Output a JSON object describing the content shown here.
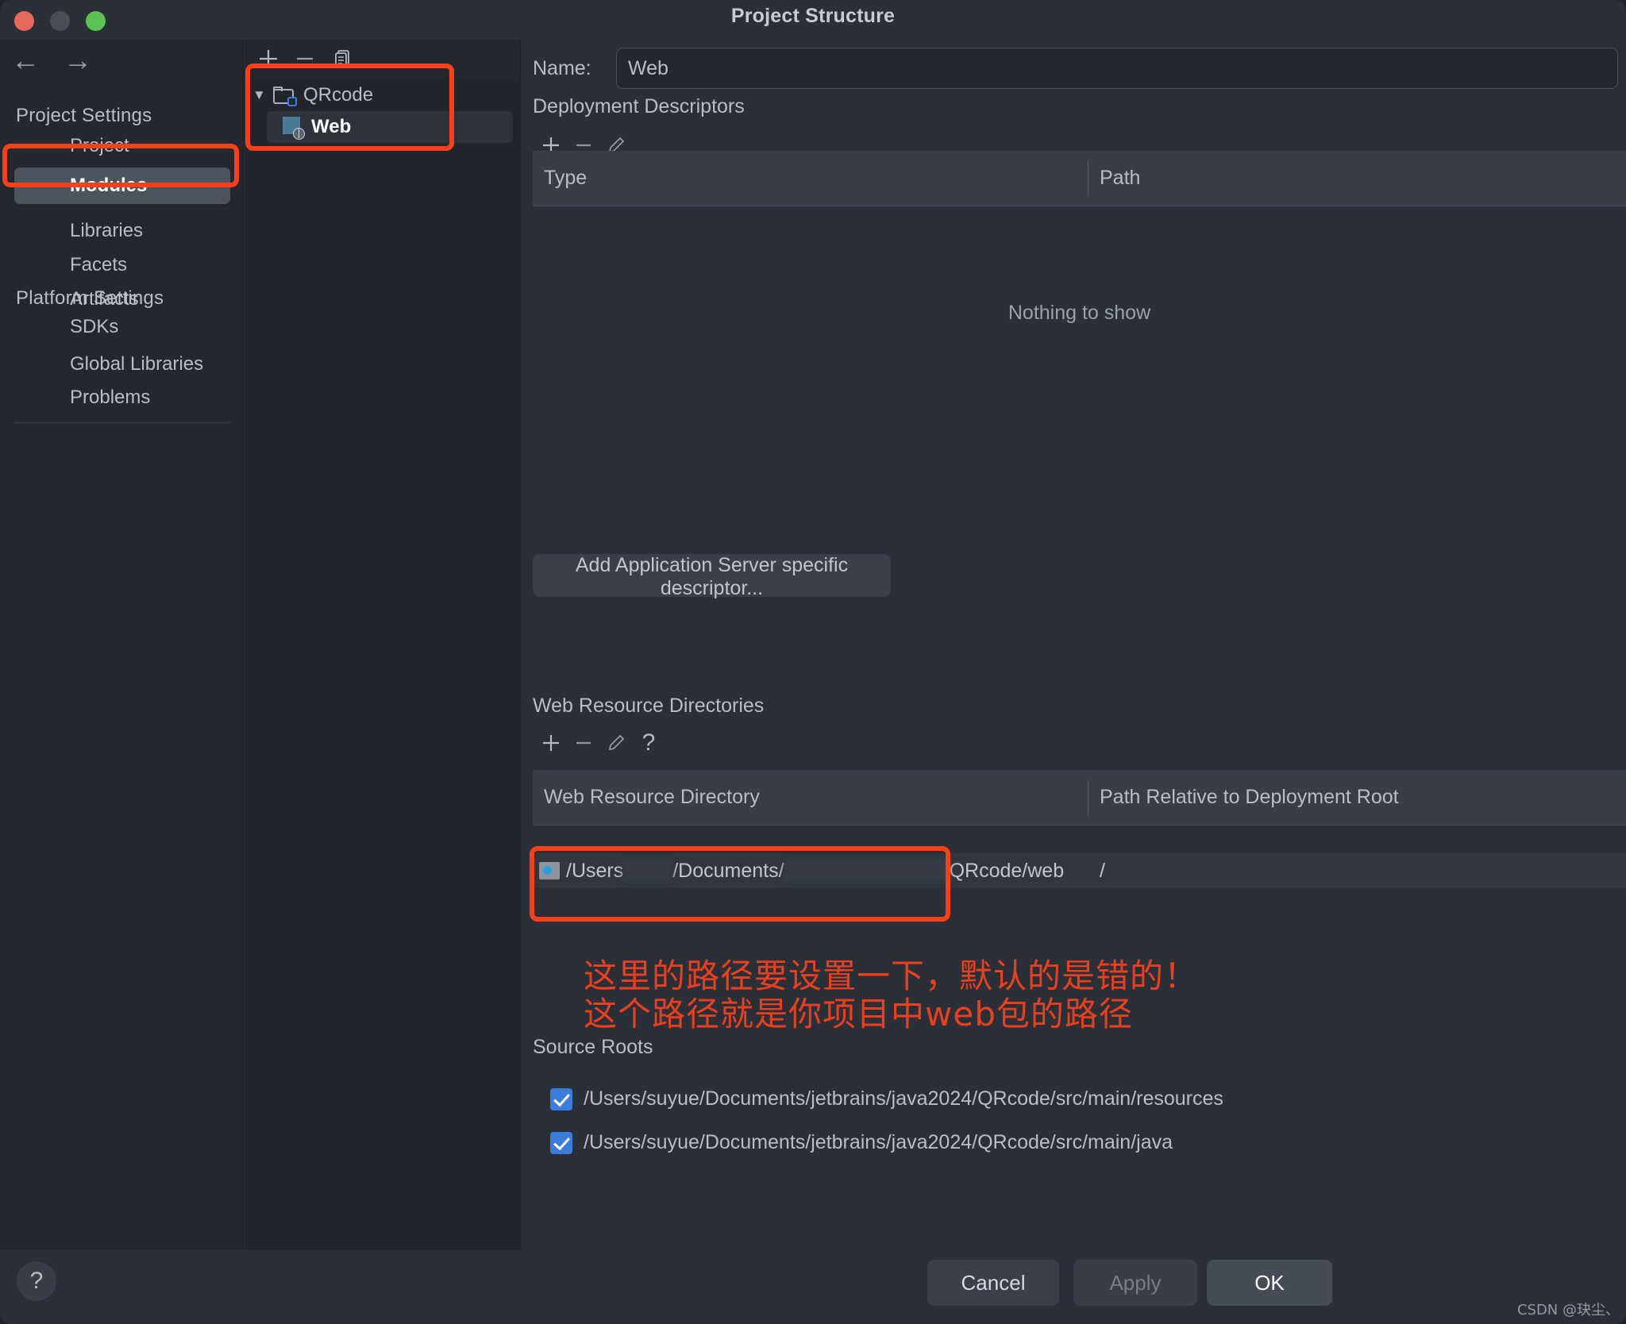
{
  "window": {
    "title": "Project Structure",
    "traffic_lights": [
      "close-red",
      "minimize-yellow",
      "maximize-green"
    ],
    "nav_back": "←",
    "nav_forward": "→"
  },
  "sidebar": {
    "groups": [
      {
        "title": "Project Settings"
      },
      {
        "title": "Platform Settings"
      }
    ],
    "items": [
      {
        "label": "Project",
        "selected": false
      },
      {
        "label": "Modules",
        "selected": true
      },
      {
        "label": "Libraries",
        "selected": false
      },
      {
        "label": "Facets",
        "selected": false
      },
      {
        "label": "Artifacts",
        "selected": false
      },
      {
        "label": "SDKs",
        "selected": false
      },
      {
        "label": "Global Libraries",
        "selected": false
      },
      {
        "label": "Problems",
        "selected": false
      }
    ]
  },
  "tree": {
    "toolbar": [
      "plus-icon",
      "minus-icon",
      "copy-icon"
    ],
    "nodes": [
      {
        "label": "QRcode",
        "icon": "module-folder-icon",
        "expanded": true,
        "selected": false
      },
      {
        "label": "Web",
        "icon": "web-facet-icon",
        "selected": true
      }
    ]
  },
  "main": {
    "name_label": "Name:",
    "name_value": "Web",
    "deployment": {
      "title": "Deployment Descriptors",
      "toolbar": [
        "plus-icon",
        "minus-icon",
        "edit-pencil-icon"
      ],
      "columns": [
        "Type",
        "Path"
      ],
      "empty_text": "Nothing to show",
      "add_button": "Add Application Server specific descriptor..."
    },
    "web_resources": {
      "title": "Web Resource Directories",
      "toolbar": [
        "plus-icon",
        "minus-icon",
        "edit-pencil-icon",
        "help-question-icon"
      ],
      "columns": [
        "Web Resource Directory",
        "Path Relative to Deployment Root"
      ],
      "rows": [
        {
          "directory_prefix": "/Users",
          "directory_mid": "/Documents/",
          "directory_suffix": "QRcode/web",
          "relative_path": "/"
        }
      ]
    },
    "annotation": {
      "line1": "这里的路径要设置一下，默认的是错的！",
      "line2": "这个路径就是你项目中web包的路径",
      "color": "#e8401f"
    },
    "source_roots": {
      "title": "Source Roots",
      "items": [
        {
          "path": "/Users/suyue/Documents/jetbrains/java2024/QRcode/src/main/resources",
          "checked": true
        },
        {
          "path": "/Users/suyue/Documents/jetbrains/java2024/QRcode/src/main/java",
          "checked": true
        }
      ]
    }
  },
  "footer": {
    "help": "?",
    "cancel": "Cancel",
    "apply": "Apply",
    "ok": "OK",
    "watermark": "CSDN @玦尘、"
  },
  "colors": {
    "accent_highlight": "#f4411a",
    "checkbox_blue": "#3b7ddd",
    "selection": "#4e5360"
  }
}
